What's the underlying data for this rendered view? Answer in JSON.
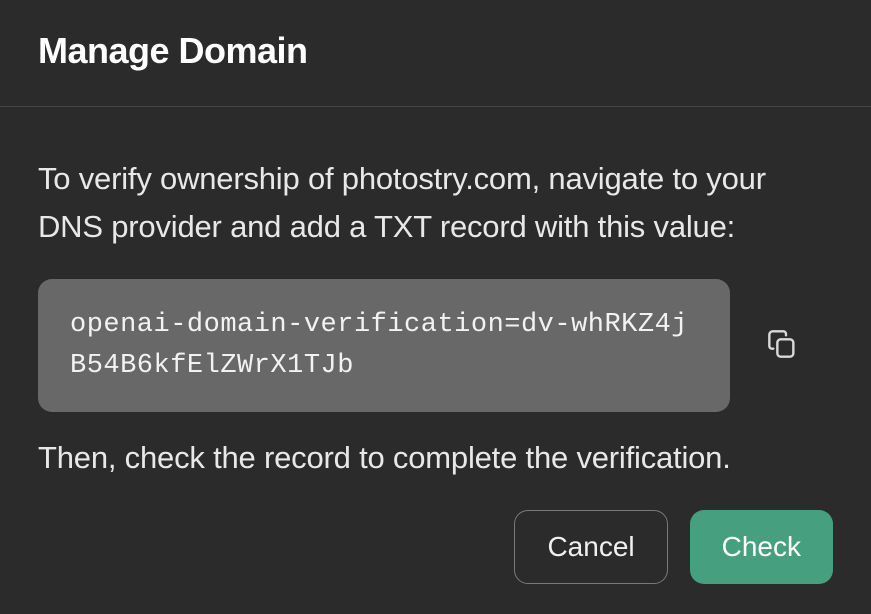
{
  "header": {
    "title": "Manage Domain"
  },
  "body": {
    "instruction_text": "To verify ownership of photostry.com, navigate to your DNS provider and add a TXT record with this value:",
    "txt_record_value": "openai-domain-verification=dv-whRKZ4jB54B6kfElZWrX1TJb",
    "followup_text": "Then, check the record to complete the verification."
  },
  "actions": {
    "cancel_label": "Cancel",
    "check_label": "Check"
  }
}
